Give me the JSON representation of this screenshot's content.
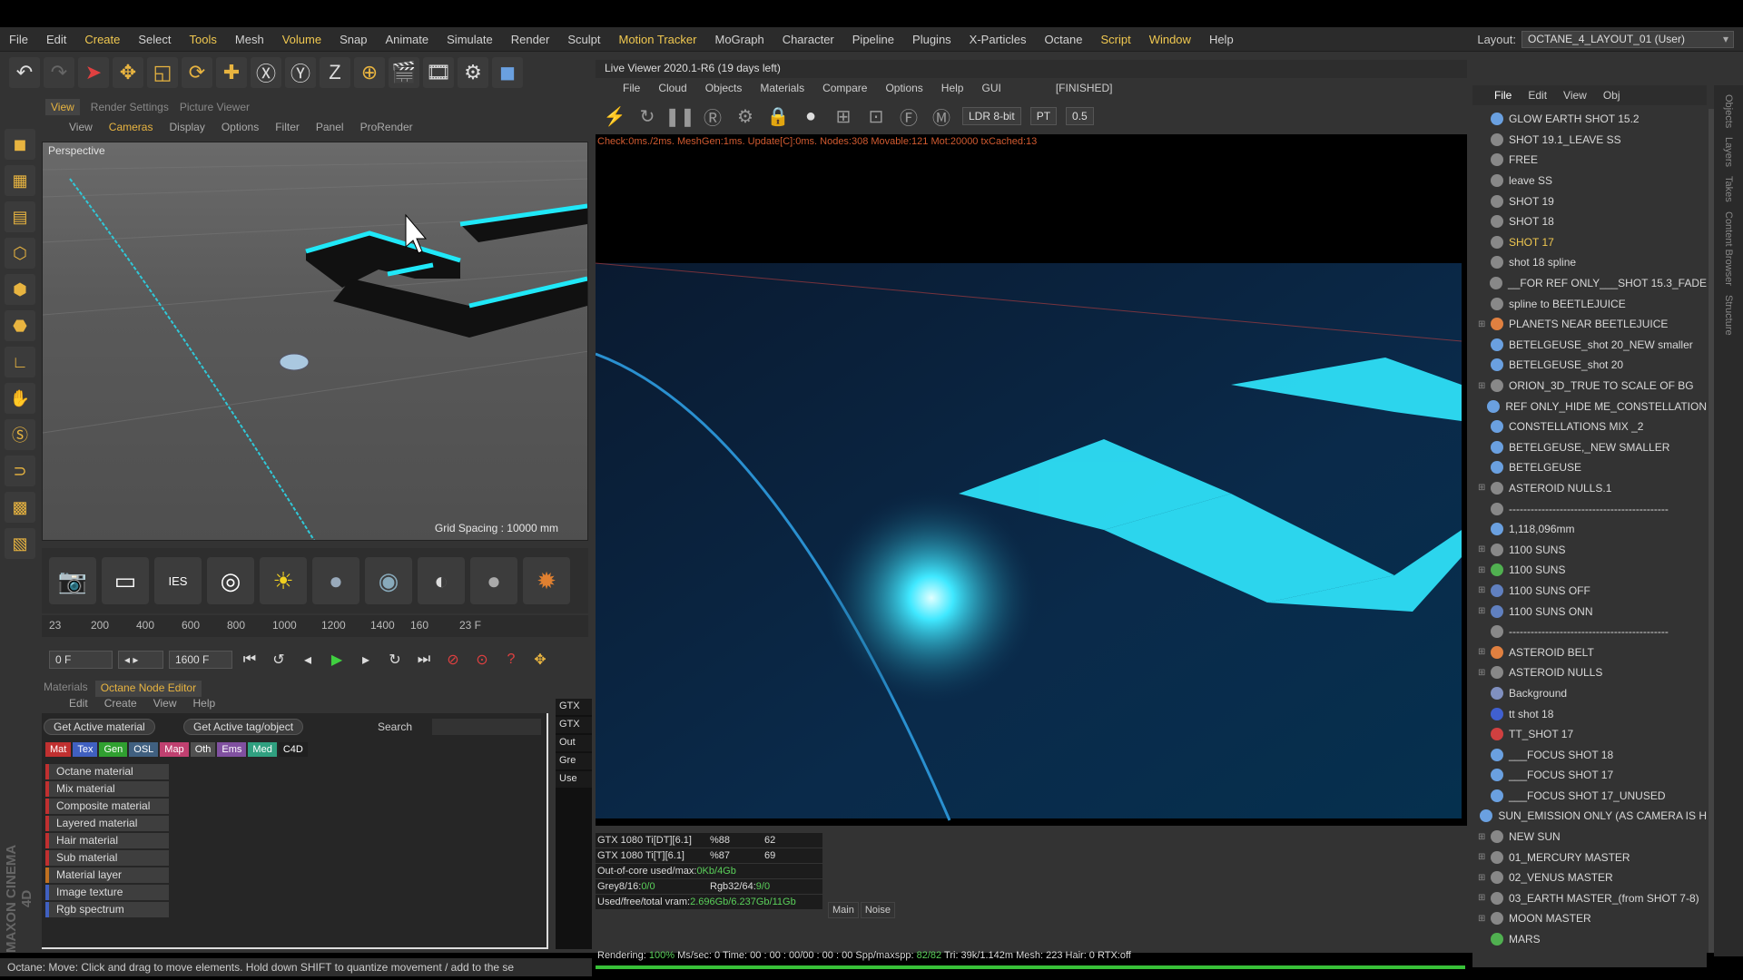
{
  "menu": [
    "File",
    "Edit",
    "Create",
    "Select",
    "Tools",
    "Mesh",
    "Volume",
    "Snap",
    "Animate",
    "Simulate",
    "Render",
    "Sculpt",
    "Motion Tracker",
    "MoGraph",
    "Character",
    "Pipeline",
    "Plugins",
    "X-Particles",
    "Octane",
    "Script",
    "Window",
    "Help"
  ],
  "layout": {
    "label": "Layout:",
    "value": "OCTANE_4_LAYOUT_01 (User)"
  },
  "viewport": {
    "tabs": [
      "View",
      "Render Settings",
      "Picture Viewer"
    ],
    "menu": [
      "View",
      "Cameras",
      "Display",
      "Options",
      "Filter",
      "Panel",
      "ProRender"
    ],
    "label": "Perspective",
    "grid": "Grid Spacing : 10000 mm"
  },
  "timeline": {
    "ticks": [
      "23",
      "200",
      "400",
      "600",
      "800",
      "1000",
      "1200",
      "1400",
      "160",
      "23 F"
    ]
  },
  "playback": {
    "start": "0 F",
    "end": "1600 F"
  },
  "node": {
    "tabs": [
      "Materials",
      "Octane Node Editor"
    ],
    "menu": [
      "Edit",
      "Create",
      "View",
      "Help"
    ],
    "btn1": "Get Active material",
    "btn2": "Get Active tag/object",
    "search": "Search",
    "cats": [
      {
        "l": "Mat",
        "c": "#c03030"
      },
      {
        "l": "Tex",
        "c": "#4060c0"
      },
      {
        "l": "Gen",
        "c": "#30a030"
      },
      {
        "l": "OSL",
        "c": "#406080"
      },
      {
        "l": "Map",
        "c": "#c04070"
      },
      {
        "l": "Oth",
        "c": "#505050"
      },
      {
        "l": "Ems",
        "c": "#8050a0"
      },
      {
        "l": "Med",
        "c": "#30a080"
      },
      {
        "l": "C4D",
        "c": "#202020"
      }
    ],
    "items": [
      "Octane material",
      "Mix material",
      "Composite material",
      "Layered material",
      "Hair material",
      "Sub material",
      "Material layer",
      "Image texture",
      "Rgb spectrum"
    ]
  },
  "live": {
    "title": "Live Viewer 2020.1-R6 (19 days left)",
    "menu": [
      "File",
      "Cloud",
      "Objects",
      "Materials",
      "Compare",
      "Options",
      "Help",
      "GUI"
    ],
    "status": "[FINISHED]",
    "ldr": "LDR 8-bit",
    "pt": "PT",
    "val": "0.5",
    "stats": "Check:0ms./2ms. MeshGen:1ms. Update[C]:0ms. Nodes:308 Movable:121 Mot:20000 txCached:13"
  },
  "gpu": {
    "r1": [
      "GTX 1080 Ti[DT][6.1]",
      "%88",
      "62"
    ],
    "r2": [
      "GTX 1080 Ti[T][6.1]",
      "%87",
      "69"
    ],
    "r3": "Out-of-core used/max:",
    "r3v": "0Kb/4Gb",
    "r4a": "Grey8/16:",
    "r4av": "0/0",
    "r4b": "Rgb32/64:",
    "r4bv": "9/0",
    "r5": "Used/free/total vram:",
    "r5v": "2.696Gb/6.237Gb/11Gb",
    "b1": "Main",
    "b2": "Noise"
  },
  "gutter": [
    "GTX",
    "GTX",
    "Out",
    "Gre",
    "Use"
  ],
  "render": {
    "a": "Rendering:",
    "b": "100%",
    "c": "Ms/sec: 0   Time: 00 : 00 : 00/00 : 00 : 00   Spp/maxspp:",
    "d": "82/82",
    "e": "Tri: 39k/1.142m   Mesh: 223   Hair: 0   RTX:off"
  },
  "status": "Octane:        Move: Click and drag to move elements. Hold down SHIFT to quantize movement / add to the se",
  "objmenu": [
    "File",
    "Edit",
    "View",
    "Obj"
  ],
  "objects": [
    {
      "n": "GLOW EARTH SHOT 15.2",
      "c": "#6aa0e0"
    },
    {
      "n": "SHOT 19.1_LEAVE SS",
      "c": "#888"
    },
    {
      "n": "FREE",
      "c": "#888"
    },
    {
      "n": "leave SS",
      "c": "#888"
    },
    {
      "n": "SHOT 19",
      "c": "#888"
    },
    {
      "n": "SHOT 18",
      "c": "#888"
    },
    {
      "n": "SHOT 17",
      "c": "#888",
      "sel": true
    },
    {
      "n": "shot 18 spline",
      "c": "#888"
    },
    {
      "n": "__FOR REF ONLY___SHOT 15.3_FADE",
      "c": "#888"
    },
    {
      "n": "spline to BEETLEJUICE",
      "c": "#888"
    },
    {
      "n": "PLANETS NEAR BEETLEJUICE",
      "c": "#e08040",
      "exp": true
    },
    {
      "n": "BETELGEUSE_shot 20_NEW smaller",
      "c": "#6aa0e0"
    },
    {
      "n": "BETELGEUSE_shot 20",
      "c": "#6aa0e0"
    },
    {
      "n": "ORION_3D_TRUE TO SCALE OF BG",
      "c": "#888",
      "exp": true
    },
    {
      "n": "REF ONLY_HIDE ME_CONSTELLATION",
      "c": "#6aa0e0"
    },
    {
      "n": "CONSTELLATIONS MIX _2",
      "c": "#6aa0e0"
    },
    {
      "n": "BETELGEUSE,_NEW SMALLER",
      "c": "#6aa0e0"
    },
    {
      "n": "BETELGEUSE",
      "c": "#6aa0e0"
    },
    {
      "n": "ASTEROID NULLS.1",
      "c": "#888",
      "exp": true
    },
    {
      "n": "--------------------------------------------",
      "c": "#888"
    },
    {
      "n": "1,118,096mm",
      "c": "#6aa0e0"
    },
    {
      "n": "1100 SUNS",
      "c": "#888",
      "exp": true
    },
    {
      "n": "1100 SUNS",
      "c": "#50b050",
      "exp": true
    },
    {
      "n": "1100 SUNS OFF",
      "c": "#6080c0",
      "exp": true
    },
    {
      "n": "1100 SUNS ONN",
      "c": "#6080c0",
      "exp": true
    },
    {
      "n": "--------------------------------------------",
      "c": "#888"
    },
    {
      "n": "ASTEROID BELT",
      "c": "#e08040",
      "exp": true
    },
    {
      "n": "ASTEROID NULLS",
      "c": "#888",
      "exp": true
    },
    {
      "n": "Background",
      "c": "#8090c0"
    },
    {
      "n": "tt shot 18",
      "c": "#4060d0"
    },
    {
      "n": "TT_SHOT 17",
      "c": "#d04040"
    },
    {
      "n": "___FOCUS SHOT 18",
      "c": "#6aa0e0"
    },
    {
      "n": "___FOCUS SHOT 17",
      "c": "#6aa0e0"
    },
    {
      "n": "___FOCUS SHOT 17_UNUSED",
      "c": "#6aa0e0"
    },
    {
      "n": "SUN_EMISSION ONLY (AS CAMERA IS H",
      "c": "#6aa0e0"
    },
    {
      "n": "NEW SUN",
      "c": "#888",
      "exp": true
    },
    {
      "n": "01_MERCURY MASTER",
      "c": "#888",
      "exp": true
    },
    {
      "n": "02_VENUS MASTER",
      "c": "#888",
      "exp": true
    },
    {
      "n": "03_EARTH MASTER_(from SHOT 7-8)",
      "c": "#888",
      "exp": true
    },
    {
      "n": "MOON MASTER",
      "c": "#888",
      "exp": true
    },
    {
      "n": "MARS",
      "c": "#50b050"
    }
  ],
  "sidetabs": [
    "Objects",
    "Layers",
    "Takes",
    "Content Browser",
    "Structure"
  ]
}
